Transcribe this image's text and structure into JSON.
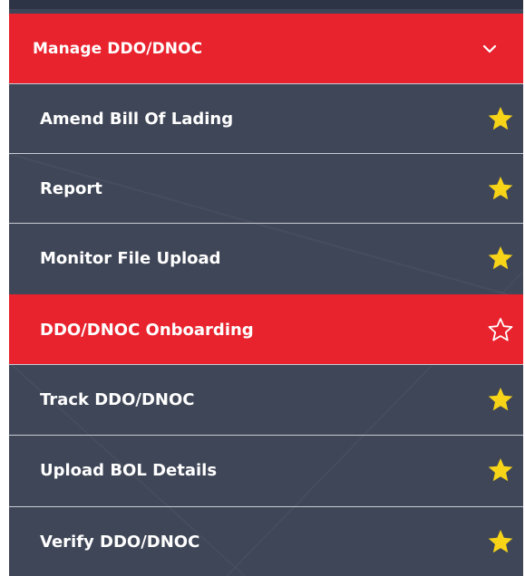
{
  "menu": {
    "header": {
      "label": "Manage DDO/DNOC",
      "icon": "chevron-down-icon"
    },
    "items": [
      {
        "label": "Amend Bill Of Lading",
        "favorite": true,
        "active": false
      },
      {
        "label": "Report",
        "favorite": true,
        "active": false
      },
      {
        "label": "Monitor File Upload",
        "favorite": true,
        "active": false
      },
      {
        "label": "DDO/DNOC Onboarding",
        "favorite": false,
        "active": true
      },
      {
        "label": "Track DDO/DNOC",
        "favorite": true,
        "active": false
      },
      {
        "label": "Upload BOL Details",
        "favorite": true,
        "active": false
      },
      {
        "label": "Verify DDO/DNOC",
        "favorite": true,
        "active": false
      }
    ]
  },
  "colors": {
    "accent": "#e8232e",
    "panel": "#3f4657",
    "star_filled": "#f7d417",
    "text": "#ffffff"
  }
}
